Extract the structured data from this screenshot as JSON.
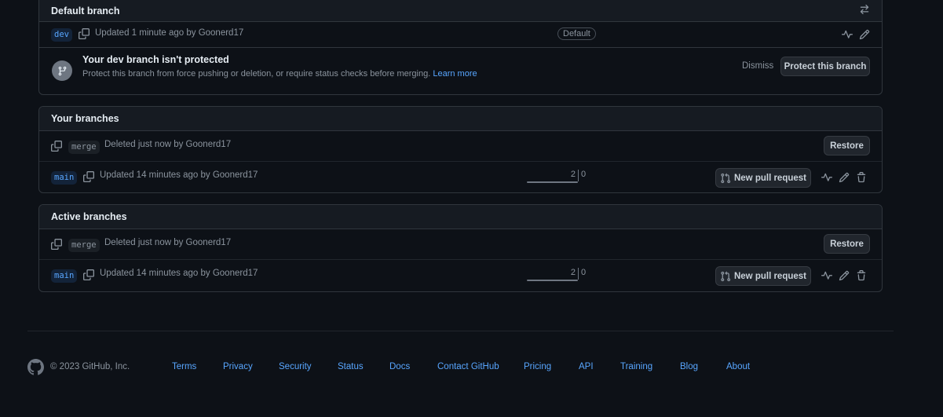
{
  "default_branch": {
    "header": "Default branch",
    "branch": {
      "name": "dev",
      "meta": "Updated 1 minute ago by Goonerd17",
      "badge": "Default"
    },
    "protection": {
      "title": "Your dev branch isn't protected",
      "description": "Protect this branch from force pushing or deletion, or require status checks before merging.",
      "learn_more": "Learn more",
      "dismiss": "Dismiss",
      "protect_button": "Protect this branch"
    }
  },
  "your_branches": {
    "header": "Your branches",
    "rows": [
      {
        "name": "merge",
        "meta": "Deleted just now by Goonerd17",
        "action": "Restore"
      },
      {
        "name": "main",
        "meta": "Updated 14 minutes ago by Goonerd17",
        "behind": "2",
        "ahead": "0",
        "action": "New pull request"
      }
    ]
  },
  "active_branches": {
    "header": "Active branches",
    "rows": [
      {
        "name": "merge",
        "meta": "Deleted just now by Goonerd17",
        "action": "Restore"
      },
      {
        "name": "main",
        "meta": "Updated 14 minutes ago by Goonerd17",
        "behind": "2",
        "ahead": "0",
        "action": "New pull request"
      }
    ]
  },
  "footer": {
    "copyright": "© 2023 GitHub, Inc.",
    "links": [
      "Terms",
      "Privacy",
      "Security",
      "Status",
      "Docs",
      "Contact GitHub",
      "Pricing",
      "API",
      "Training",
      "Blog",
      "About"
    ]
  },
  "colors": {
    "background": "#0d1117",
    "accent": "#58a6ff",
    "border": "#30363d"
  }
}
